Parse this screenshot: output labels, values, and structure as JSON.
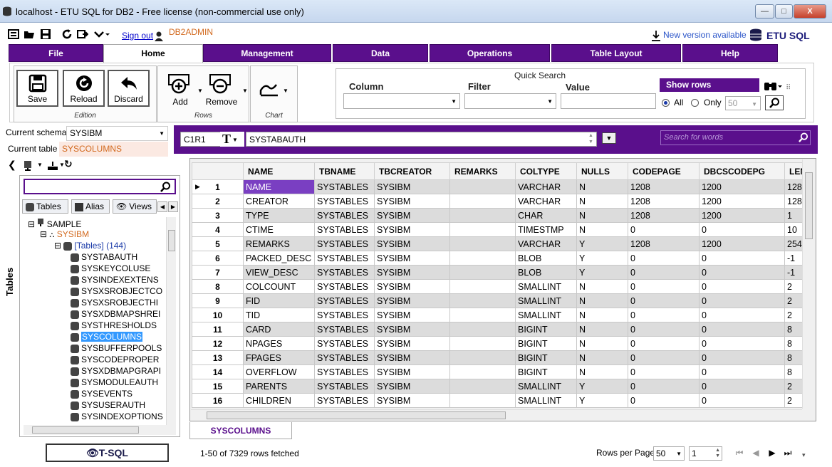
{
  "window": {
    "title": "localhost - ETU SQL for DB2 - Free license (non-commercial use only)",
    "minimize": "—",
    "maximize": "□",
    "close": "X"
  },
  "toolbar": {
    "sign_out": "Sign out",
    "user": "DB2ADMIN",
    "new_version": "New version available",
    "brand": "ETU SQL"
  },
  "menu": {
    "tabs": [
      "File",
      "Home",
      "Management",
      "Data",
      "Operations",
      "Table Layout",
      "Help"
    ],
    "active": "Home"
  },
  "ribbon": {
    "edition": {
      "label": "Edition",
      "save": "Save",
      "reload": "Reload",
      "discard": "Discard"
    },
    "rows": {
      "label": "Rows",
      "add": "Add",
      "remove": "Remove"
    },
    "chart": {
      "label": "Chart"
    },
    "quick_search": {
      "title": "Quick Search",
      "column_label": "Column",
      "filter_label": "Filter",
      "value_label": "Value",
      "show_rows": "Show rows",
      "all_label": "All",
      "only_label": "Only",
      "only_count": "50"
    }
  },
  "schema": {
    "current_schema_label": "Current schema :",
    "current_schema": "SYSIBM",
    "current_table_label": "Current table :",
    "current_table": "SYSCOLUMNS"
  },
  "editor": {
    "cell_ref": "C1R1",
    "t_button": "T",
    "cell_value": "SYSTABAUTH",
    "search_placeholder": "Search for words"
  },
  "left_panel": {
    "subtabs": [
      "Tables",
      "Alias",
      "Views"
    ],
    "vertical_tab": "Tables",
    "tree": {
      "root": "SAMPLE",
      "schema": "SYSIBM",
      "tables_node": "[Tables] (144)",
      "tables": [
        "SYSTABAUTH",
        "SYSKEYCOLUSE",
        "SYSINDEXEXTENS",
        "SYSXSROBJECTCO",
        "SYSXSROBJECTHI",
        "SYSXDBMAPSHREI",
        "SYSTHRESHOLDS",
        "SYSCOLUMNS",
        "SYSBUFFERPOOLS",
        "SYSCODEPROPER",
        "SYSXDBMAPGRAPI",
        "SYSMODULEAUTH",
        "SYSEVENTS",
        "SYSUSERAUTH",
        "SYSINDEXOPTIONS"
      ],
      "selected": "SYSCOLUMNS"
    },
    "tsql": "T-SQL"
  },
  "grid": {
    "columns": [
      "NAME",
      "TBNAME",
      "TBCREATOR",
      "REMARKS",
      "COLTYPE",
      "NULLS",
      "CODEPAGE",
      "DBCSCODEPG",
      "LEN"
    ],
    "rows": [
      [
        "1",
        "NAME",
        "SYSTABLES",
        "SYSIBM",
        "",
        "VARCHAR",
        "N",
        "1208",
        "1200",
        "128"
      ],
      [
        "2",
        "CREATOR",
        "SYSTABLES",
        "SYSIBM",
        "",
        "VARCHAR",
        "N",
        "1208",
        "1200",
        "128"
      ],
      [
        "3",
        "TYPE",
        "SYSTABLES",
        "SYSIBM",
        "",
        "CHAR",
        "N",
        "1208",
        "1200",
        "1"
      ],
      [
        "4",
        "CTIME",
        "SYSTABLES",
        "SYSIBM",
        "",
        "TIMESTMP",
        "N",
        "0",
        "0",
        "10"
      ],
      [
        "5",
        "REMARKS",
        "SYSTABLES",
        "SYSIBM",
        "",
        "VARCHAR",
        "Y",
        "1208",
        "1200",
        "254"
      ],
      [
        "6",
        "PACKED_DESC",
        "SYSTABLES",
        "SYSIBM",
        "",
        "BLOB",
        "Y",
        "0",
        "0",
        "-1"
      ],
      [
        "7",
        "VIEW_DESC",
        "SYSTABLES",
        "SYSIBM",
        "",
        "BLOB",
        "Y",
        "0",
        "0",
        "-1"
      ],
      [
        "8",
        "COLCOUNT",
        "SYSTABLES",
        "SYSIBM",
        "",
        "SMALLINT",
        "N",
        "0",
        "0",
        "2"
      ],
      [
        "9",
        "FID",
        "SYSTABLES",
        "SYSIBM",
        "",
        "SMALLINT",
        "N",
        "0",
        "0",
        "2"
      ],
      [
        "10",
        "TID",
        "SYSTABLES",
        "SYSIBM",
        "",
        "SMALLINT",
        "N",
        "0",
        "0",
        "2"
      ],
      [
        "11",
        "CARD",
        "SYSTABLES",
        "SYSIBM",
        "",
        "BIGINT",
        "N",
        "0",
        "0",
        "8"
      ],
      [
        "12",
        "NPAGES",
        "SYSTABLES",
        "SYSIBM",
        "",
        "BIGINT",
        "N",
        "0",
        "0",
        "8"
      ],
      [
        "13",
        "FPAGES",
        "SYSTABLES",
        "SYSIBM",
        "",
        "BIGINT",
        "N",
        "0",
        "0",
        "8"
      ],
      [
        "14",
        "OVERFLOW",
        "SYSTABLES",
        "SYSIBM",
        "",
        "BIGINT",
        "N",
        "0",
        "0",
        "8"
      ],
      [
        "15",
        "PARENTS",
        "SYSTABLES",
        "SYSIBM",
        "",
        "SMALLINT",
        "Y",
        "0",
        "0",
        "2"
      ],
      [
        "16",
        "CHILDREN",
        "SYSTABLES",
        "SYSIBM",
        "",
        "SMALLINT",
        "Y",
        "0",
        "0",
        "2"
      ]
    ],
    "sheet_tab": "SYSCOLUMNS"
  },
  "status": {
    "rows_fetched": "1-50 of 7329 rows fetched",
    "rows_per_page_label": "Rows per Page:",
    "rows_per_page": "50",
    "page": "1"
  },
  "colors": {
    "accent": "#5a0f8c",
    "selected_cell": "#7a3fc2",
    "link": "#0000cc",
    "user": "#d2691e"
  }
}
